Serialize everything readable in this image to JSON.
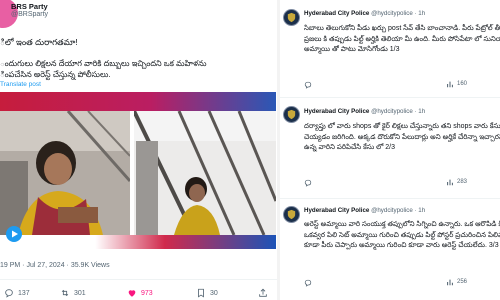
{
  "left_post": {
    "author_name": "BRS Party",
    "author_handle": "@BRSparty",
    "line1": "ిలో ఇంత దురాగతమా!",
    "line2": "ందుగులు లిక్షలన దేయాగ వారికి దబ్బులు ఇచ్చిందని ఒక మహిళను",
    "line3": "ింపచేసిన అరెస్ట్ చేస్తున్న పోలీసులు.",
    "translate_label": "Translate post",
    "meta": "19 PM · Jul 27, 2024 · 35.9K Views",
    "actions": {
      "reply_count": "137",
      "retweet_count": "301",
      "like_count": "973",
      "bookmark_count": "30"
    },
    "colors": {
      "like": "#f91880",
      "link": "#1d9bf0",
      "banner_red": "#c61d3c",
      "banner_blue": "#2a58b6"
    }
  },
  "right_thread": {
    "tweets": [
      {
        "author_name": "Hyderabad City Police",
        "handle_time": "@hydcitypolice · 1h",
        "lines": [
          "సిబాలు తెలుగుకోని పీడు ఖర్చు post సేవ్ తేసి బాంచానాడి. పీరు పేట్రోల్ తీస్తో",
          "ప్రజలు కి తప్పుడు పిల్ట్ అర్హికి తెలియా మీ ఉంది. మీరు పోసిపేటా లో సునియడి",
          "అమ్మాయి తో పాటు మోసిగోండు 1/3"
        ],
        "views": "160"
      },
      {
        "author_name": "Hyderabad City Police",
        "handle_time": "@hydcitypolice · 1h",
        "lines": [
          "దర్యాప్తు లో వారు shops తో కైర్ లిక్షలు చేస్తున్నారు తని shops వారు కేసు",
          "చెయ్యడం జరిగింది. అక్కడ దొరుకోని పేలుదార్లు అని అర్హికే చేరిన్నా ఇచ్చారని అరెస్ట్",
          "ఉన్న వారిని పరిపిచేసి కేసు లో 2/3"
        ],
        "views": "283"
      },
      {
        "author_name": "Hyderabad City Police",
        "handle_time": "@hydcitypolice · 1h",
        "lines": [
          "అరెస్ట్ అమ్మాయి వారి సంయుక్త తప్పులోని సిగ్నించి ఉన్నారు. ఒక ఆరొపిడి కి సెట్ కోని పిన్",
          "ఒకవ్వర పిలి సెట్ అమ్మాయి గురించి తప్పుడు పిల్ట్ పోస్టర్ ప్రచురించిన పిలిపారు. పోలీస్ వారు",
          "కూడా పీరు చెప్పారు అమ్మాయి గురించి కూడా వారు అరెస్ట్ చేయలేదు. 3/3"
        ],
        "views": "256"
      }
    ],
    "colors": {
      "avatar_bg": "#1b2f4a",
      "muted": "#536471"
    }
  }
}
